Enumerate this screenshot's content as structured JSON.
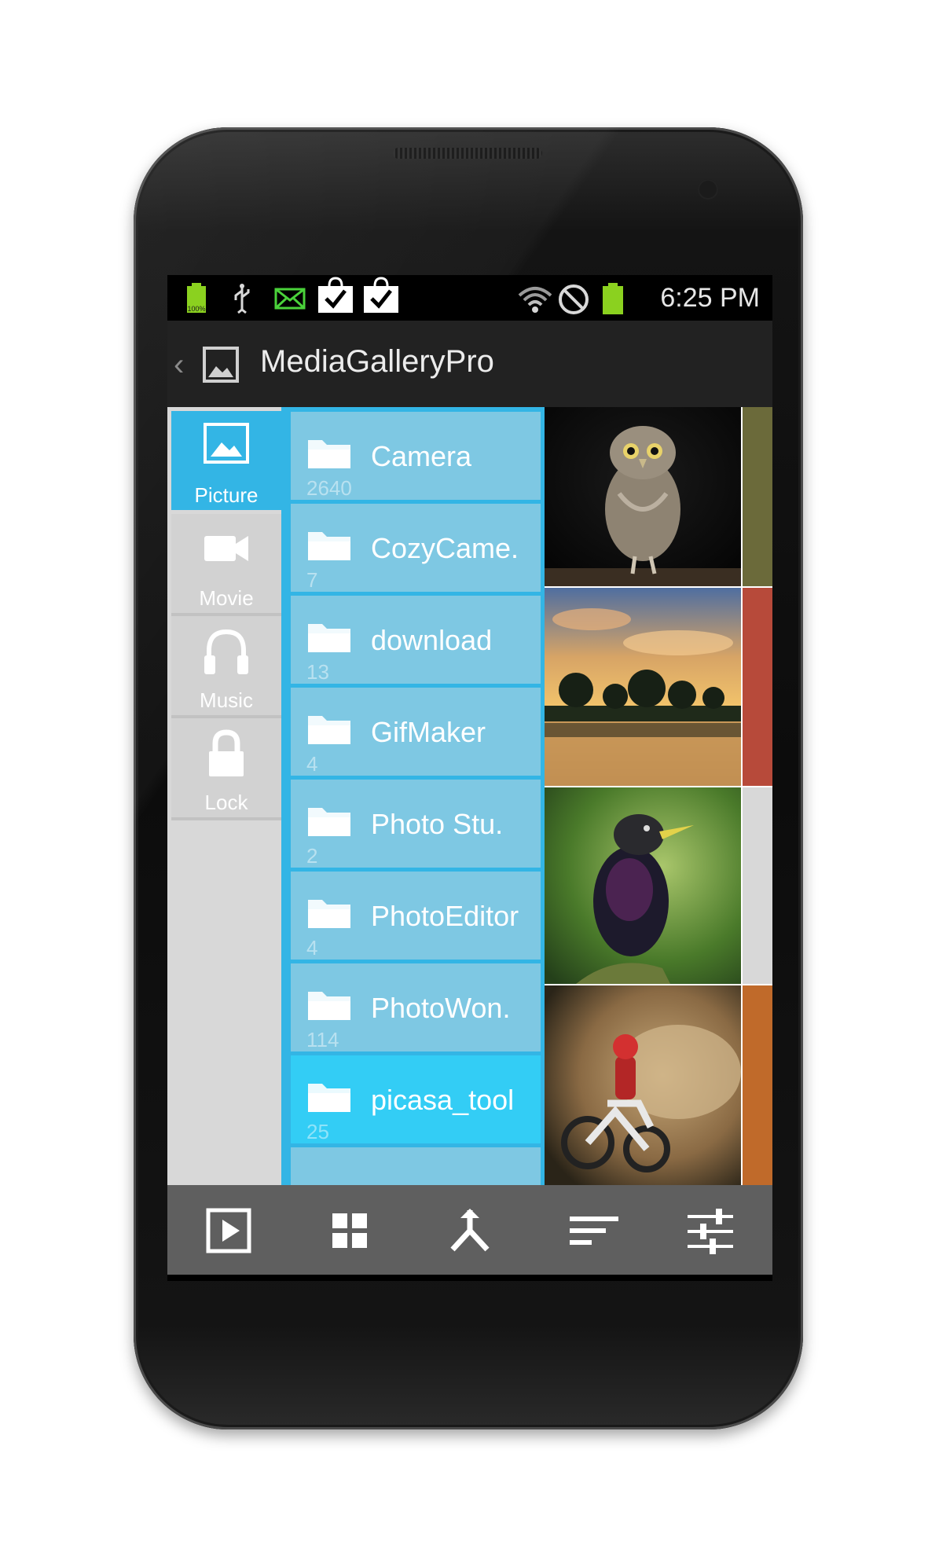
{
  "status_bar": {
    "battery_small_label": "100%",
    "time": "6:25 PM"
  },
  "action_bar": {
    "title": "MediaGalleryPro"
  },
  "categories": [
    {
      "label": "Picture",
      "icon": "picture-icon",
      "active": true
    },
    {
      "label": "Movie",
      "icon": "video-camera-icon",
      "active": false
    },
    {
      "label": "Music",
      "icon": "headphones-icon",
      "active": false
    },
    {
      "label": "Lock",
      "icon": "lock-icon",
      "active": false
    }
  ],
  "folders": [
    {
      "name": "Camera",
      "count": "2640"
    },
    {
      "name": "CozyCame.",
      "count": "7"
    },
    {
      "name": "download",
      "count": "13"
    },
    {
      "name": "GifMaker",
      "count": "4"
    },
    {
      "name": "Photo Stu.",
      "count": "2"
    },
    {
      "name": "PhotoEditor",
      "count": "4"
    },
    {
      "name": "PhotoWon.",
      "count": "114"
    },
    {
      "name": "picasa_tool",
      "count": "25"
    }
  ],
  "thumbnails": [
    "owl",
    "sunset-trees",
    "starling-bird",
    "dirt-bike"
  ],
  "bottom_bar": [
    "slideshow-icon",
    "grid-view-icon",
    "merge-icon",
    "sort-icon",
    "settings-sliders-icon"
  ],
  "colors": {
    "accent": "#33b5e5",
    "folder_bg": "#7ec8e3",
    "active_folder_bg": "#33cdf5",
    "action_bar": "#222222",
    "bottom_bar": "#5f5f5f"
  }
}
